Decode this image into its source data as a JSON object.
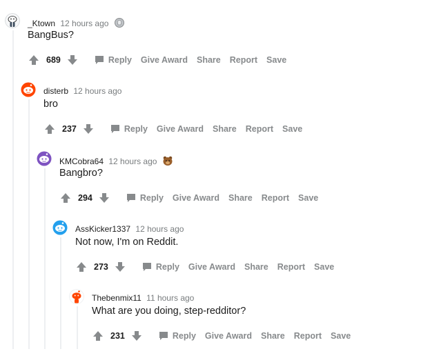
{
  "comments": [
    {
      "author": "_Ktown",
      "time": "12 hours ago",
      "body": "BangBus?",
      "score": "689",
      "award_icon": "silver-award-icon"
    },
    {
      "author": "disterb",
      "time": "12 hours ago",
      "body": "bro",
      "score": "237"
    },
    {
      "author": "KMCobra64",
      "time": "12 hours ago",
      "body": "Bangbro?",
      "score": "294",
      "award_icon": "bear-award-icon"
    },
    {
      "author": "AssKicker1337",
      "time": "12 hours ago",
      "body": "Not now, I'm on Reddit.",
      "score": "273"
    },
    {
      "author": "Thebenmix11",
      "time": "11 hours ago",
      "body": "What are you doing, step-redditor?",
      "score": "231"
    }
  ],
  "actions": {
    "reply": "Reply",
    "give_award": "Give Award",
    "share": "Share",
    "report": "Report",
    "save": "Save"
  },
  "colors": {
    "thread_line": "#edeff1",
    "meta_gray": "#787c7e",
    "action_gray": "#878a8c",
    "avatar_orange": "#ff4500",
    "avatar_purple": "#7e53c1",
    "avatar_blue": "#24a0ed"
  }
}
